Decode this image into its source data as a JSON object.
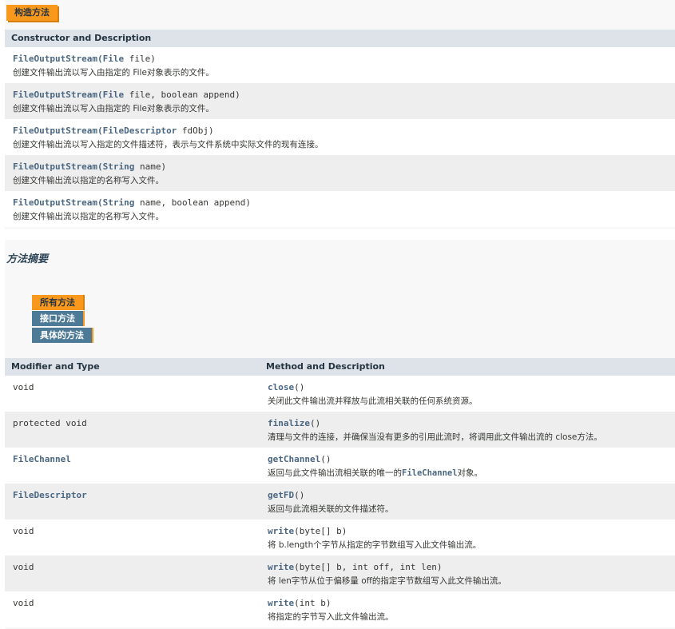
{
  "constructor_section": {
    "tab_label": "构造方法",
    "header": "Constructor and Description",
    "rows": [
      {
        "name": "FileOutputStream",
        "open": "(",
        "ptype": "File",
        "params": " file)",
        "description": "创建文件输出流以写入由指定的 File对象表示的文件。"
      },
      {
        "name": "FileOutputStream",
        "open": "(",
        "ptype": "File",
        "params": " file, boolean append)",
        "description": "创建文件输出流以写入由指定的 File对象表示的文件。"
      },
      {
        "name": "FileOutputStream",
        "open": "(",
        "ptype": "FileDescriptor",
        "params": " fdObj)",
        "description": "创建文件输出流以写入指定的文件描述符，表示与文件系统中实际文件的现有连接。"
      },
      {
        "name": "FileOutputStream",
        "open": "(",
        "ptype": "String",
        "params": " name)",
        "description": "创建文件输出流以指定的名称写入文件。"
      },
      {
        "name": "FileOutputStream",
        "open": "(",
        "ptype": "String",
        "params": " name, boolean append)",
        "description": "创建文件输出流以指定的名称写入文件。"
      }
    ]
  },
  "method_section": {
    "title": "方法摘要",
    "tabs": [
      {
        "label": "所有方法",
        "active": true
      },
      {
        "label": "接口方法",
        "active": false
      },
      {
        "label": "具体的方法",
        "active": false
      }
    ],
    "headers": {
      "type": "Modifier and Type",
      "method": "Method and Description"
    },
    "rows": [
      {
        "type": "void",
        "method": "close",
        "params": "()",
        "desc_a": "关闭此文件输出流并释放与此流相关联的任何系统资源。",
        "desc_link": "",
        "desc_b": ""
      },
      {
        "type": "protected void",
        "method": "finalize",
        "params": "()",
        "desc_a": "清理与文件的连接，并确保当没有更多的引用此流时，将调用此文件输出流的 close方法。",
        "desc_link": "",
        "desc_b": ""
      },
      {
        "type": "FileChannel",
        "method": "getChannel",
        "params": "()",
        "desc_a": "返回与此文件输出流相关联的唯一的",
        "desc_link": "FileChannel",
        "desc_b": "对象。"
      },
      {
        "type": "FileDescriptor",
        "method": "getFD",
        "params": "()",
        "desc_a": "返回与此流相关联的文件描述符。",
        "desc_link": "",
        "desc_b": ""
      },
      {
        "type": "void",
        "method": "write",
        "params": "(byte[] b)",
        "desc_a": "将 b.length个字节从指定的字节数组写入此文件输出流。",
        "desc_link": "",
        "desc_b": ""
      },
      {
        "type": "void",
        "method": "write",
        "params": "(byte[] b, int off, int len)",
        "desc_a": "将 len字节从位于偏移量 off的指定字节数组写入此文件输出流。",
        "desc_link": "",
        "desc_b": ""
      },
      {
        "type": "void",
        "method": "write",
        "params": "(int b)",
        "desc_a": "将指定的字节写入此文件输出流。",
        "desc_link": "",
        "desc_b": ""
      }
    ]
  },
  "colors": {
    "accent": "#f8981d",
    "tab_inactive": "#4d7a97",
    "link": "#4a6782",
    "header_bg": "#dee3e9",
    "row_alt": "#eeeeef"
  }
}
